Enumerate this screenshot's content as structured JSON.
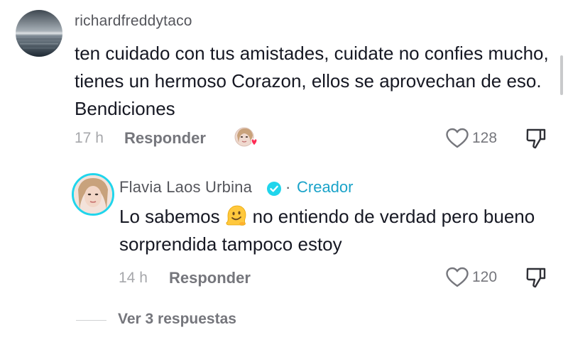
{
  "comment": {
    "username": "richardfreddytaco",
    "text": "ten cuidado con tus amistades, cuidate no confies mucho, tienes un hermoso Corazon, ellos se aprovechan de eso. Bendiciones",
    "time": "17 h",
    "reply_label": "Responder",
    "likes": "128"
  },
  "reply": {
    "author": "Flavia Laos Urbina",
    "separator": "·",
    "badge": "Creador",
    "text_before_emoji": "Lo sabemos",
    "text_after_emoji": "no entiendo de verdad pero bueno sorprendida tampoco estoy",
    "time": "14 h",
    "reply_label": "Responder",
    "likes": "120"
  },
  "view_more": "Ver 3 respuestas",
  "icons": {
    "like": "heart-outline-icon",
    "dislike": "thumbs-down-icon",
    "verified": "verified-check-icon",
    "liked_by_creator": "creator-liked-avatar-icon",
    "emoji": "melting-face-emoji"
  },
  "colors": {
    "accent": "#20d5ec",
    "creator_label": "#1aa3c9",
    "heart": "#fe2c55"
  }
}
